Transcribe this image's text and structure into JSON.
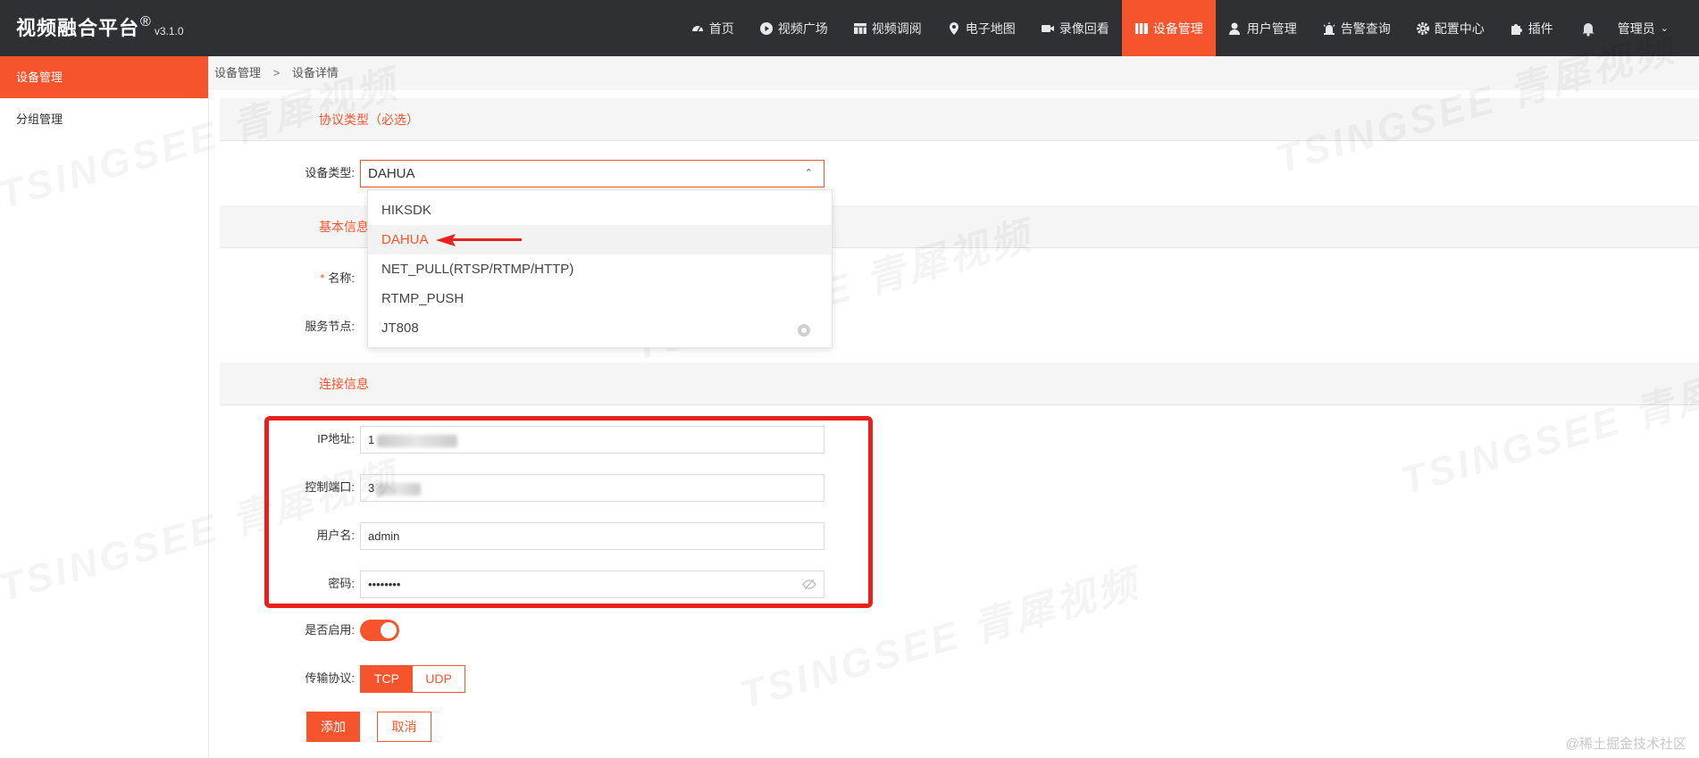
{
  "app": {
    "title": "视频融合平台",
    "reg": "®",
    "version": "v3.1.0"
  },
  "nav": [
    {
      "label": "首页",
      "icon": "dashboard-icon"
    },
    {
      "label": "视频广场",
      "icon": "play-circle-icon"
    },
    {
      "label": "视频调阅",
      "icon": "grid-icon"
    },
    {
      "label": "电子地图",
      "icon": "map-pin-icon"
    },
    {
      "label": "录像回看",
      "icon": "video-camera-icon"
    },
    {
      "label": "设备管理",
      "icon": "device-icon",
      "active": true
    },
    {
      "label": "用户管理",
      "icon": "user-icon"
    },
    {
      "label": "告警查询",
      "icon": "alarm-icon"
    },
    {
      "label": "配置中心",
      "icon": "gear-icon"
    },
    {
      "label": "插件",
      "icon": "puzzle-icon"
    }
  ],
  "header": {
    "user_label": "管理员"
  },
  "sidebar": {
    "items": [
      {
        "label": "设备管理",
        "active": true
      },
      {
        "label": "分组管理"
      }
    ]
  },
  "breadcrumb": {
    "parent": "设备管理",
    "separator": ">",
    "current": "设备详情"
  },
  "sections": {
    "protocol": "协议类型（必选）",
    "basic": "基本信息",
    "connection": "连接信息"
  },
  "form": {
    "device_type_label": "设备类型:",
    "device_type_value": "DAHUA",
    "name_required_mark": "*",
    "name_label": "名称:",
    "node_label": "服务节点:",
    "ip_label": "IP地址:",
    "ip_value_prefix": "1",
    "port_label": "控制端口:",
    "port_value_prefix": "3",
    "username_label": "用户名:",
    "username_value": "admin",
    "password_label": "密码:",
    "password_value": "••••••••",
    "enable_label": "是否启用:",
    "enabled": true,
    "transport_label": "传输协议:",
    "transport_options": [
      "TCP",
      "UDP"
    ],
    "transport_selected": "TCP",
    "submit_label": "添加",
    "cancel_label": "取消"
  },
  "dropdown": {
    "options": [
      "HIKSDK",
      "DAHUA",
      "NET_PULL(RTSP/RTMP/HTTP)",
      "RTMP_PUSH",
      "JT808"
    ],
    "selected": "DAHUA"
  },
  "watermark": "TSINGSEE 青犀视频",
  "footer_mark": "@稀土掘金技术社区",
  "colors": {
    "accent": "#f5542d",
    "topbar": "#2e3033",
    "annotation": "#e8211c"
  }
}
